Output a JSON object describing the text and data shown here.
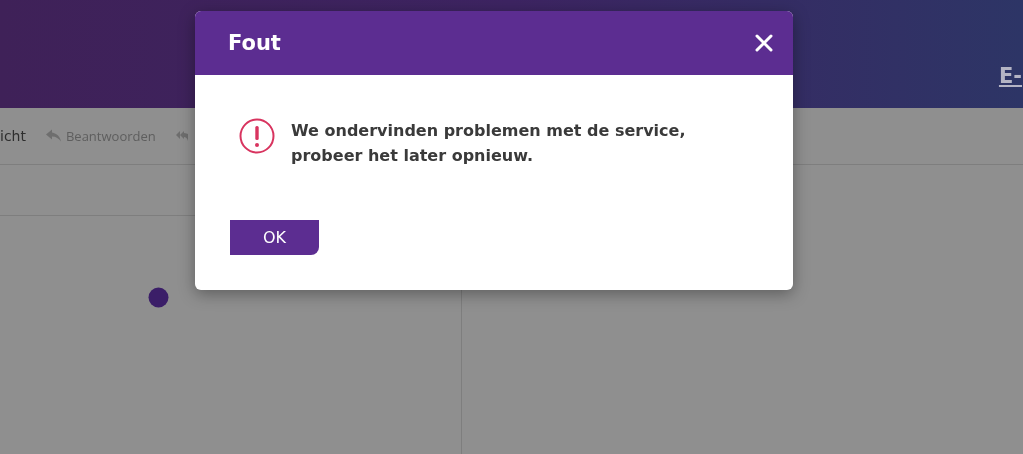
{
  "header": {
    "link": "E-"
  },
  "toolbar": [
    {
      "kind": "text",
      "label": "icht"
    },
    {
      "kind": "reply",
      "label": "Beantwoorden"
    },
    {
      "kind": "reply-all"
    }
  ],
  "content": {
    "loading": true
  },
  "dialog": {
    "title": "Fout",
    "message": "We ondervinden problemen met de service, probeer het later opnieuw.",
    "button": "OK"
  }
}
